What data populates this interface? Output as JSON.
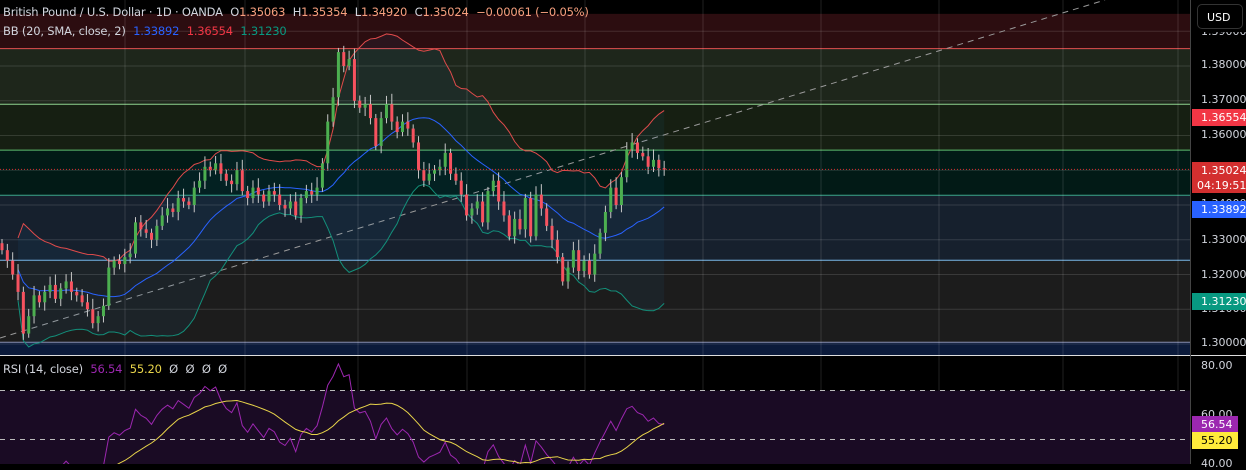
{
  "header": {
    "symbol": "British Pound / U.S. Dollar · 1D · OANDA",
    "open_label": "O",
    "open": "1.35063",
    "high_label": "H",
    "high": "1.35354",
    "low_label": "L",
    "low": "1.34920",
    "close_label": "C",
    "close": "1.35024",
    "change": "−0.00061 (−0.05%)"
  },
  "bb_legend": {
    "label": "BB (20, SMA, close, 2)",
    "basis": "1.33892",
    "upper": "1.36554",
    "lower": "1.31230"
  },
  "rsi_legend": {
    "label": "RSI (14, close)",
    "rsi": "56.54",
    "rsi_ma": "55.20",
    "empty": [
      "Ø",
      "Ø",
      "Ø",
      "Ø"
    ]
  },
  "axis": {
    "currency_button": "USD",
    "price_ticks": [
      "1.39000",
      "1.38000",
      "1.37000",
      "1.36000",
      "1.34000",
      "1.33000",
      "1.32000",
      "1.31000",
      "1.30000"
    ],
    "badge_upper": "1.36554",
    "badge_last": "1.35024",
    "countdown": "04:19:51",
    "badge_basis": "1.33892",
    "badge_lower": "1.31230",
    "rsi_ticks": [
      "80.00",
      "60.00",
      "40.00"
    ],
    "badge_rsi": "56.54",
    "badge_rsi_ma": "55.20"
  },
  "colors": {
    "up": "#4caf50",
    "down": "#f7525f",
    "upper": "#e04b4b",
    "basis": "#2962ff",
    "lower": "#138f7a",
    "rsi": "#9c27b0",
    "rsi_ma": "#e8d44a",
    "last": "#d32f2f"
  },
  "chart_data": {
    "type": "candlestick",
    "title": "British Pound / U.S. Dollar · 1D · OANDA",
    "ylim": [
      1.295,
      1.39
    ],
    "closes": [
      1.327,
      1.324,
      1.32,
      1.315,
      1.303,
      1.308,
      1.314,
      1.312,
      1.315,
      1.317,
      1.313,
      1.316,
      1.318,
      1.315,
      1.314,
      1.312,
      1.31,
      1.306,
      1.308,
      1.311,
      1.322,
      1.324,
      1.323,
      1.325,
      1.326,
      1.335,
      1.333,
      1.332,
      1.33,
      1.334,
      1.337,
      1.339,
      1.338,
      1.342,
      1.341,
      1.34,
      1.345,
      1.347,
      1.351,
      1.35,
      1.352,
      1.349,
      1.347,
      1.346,
      1.35,
      1.344,
      1.342,
      1.345,
      1.343,
      1.341,
      1.344,
      1.343,
      1.34,
      1.339,
      1.341,
      1.337,
      1.342,
      1.344,
      1.343,
      1.345,
      1.352,
      1.364,
      1.371,
      1.384,
      1.38,
      1.382,
      1.37,
      1.368,
      1.369,
      1.365,
      1.357,
      1.365,
      1.369,
      1.364,
      1.361,
      1.364,
      1.362,
      1.358,
      1.35,
      1.347,
      1.349,
      1.35,
      1.351,
      1.355,
      1.349,
      1.347,
      1.343,
      1.337,
      1.339,
      1.341,
      1.335,
      1.344,
      1.347,
      1.341,
      1.337,
      1.331,
      1.336,
      1.333,
      1.342,
      1.331,
      1.343,
      1.339,
      1.334,
      1.33,
      1.325,
      1.318,
      1.322,
      1.327,
      1.321,
      1.324,
      1.32,
      1.326,
      1.332,
      1.338,
      1.345,
      1.34,
      1.348,
      1.356,
      1.358,
      1.355,
      1.354,
      1.351,
      1.353,
      1.3506,
      1.3502
    ],
    "zones": [
      {
        "from": 1.385,
        "to": 1.395,
        "fill": "#2c0d10",
        "line": "#e05050"
      },
      {
        "from": 1.369,
        "to": 1.385,
        "fill": "#1e261b",
        "line": "#8fd48f"
      },
      {
        "from": 1.3558,
        "to": 1.369,
        "fill": "#161f12",
        "line": "#5fbf6f"
      },
      {
        "from": 1.3428,
        "to": 1.3558,
        "fill": "#021a16",
        "line": "#3aa58a"
      },
      {
        "from": 1.3241,
        "to": 1.3428,
        "fill": "#16202d",
        "line": "#7ab8e8"
      },
      {
        "from": 1.3005,
        "to": 1.3241,
        "fill": "#1c1c1c",
        "line": "#8a8fb0"
      },
      {
        "from": 1.29,
        "to": 1.3005,
        "fill": "#0b1a3a",
        "line": null
      }
    ],
    "last_price": 1.35024,
    "bb": {
      "length": 20,
      "mult": 2,
      "basis": 1.33892,
      "upper": 1.36554,
      "lower": 1.3123
    },
    "rsi": {
      "length": 14,
      "value": 56.54,
      "ma": 55.2,
      "levels": [
        70,
        50
      ],
      "ylim": [
        36,
        84
      ]
    }
  }
}
